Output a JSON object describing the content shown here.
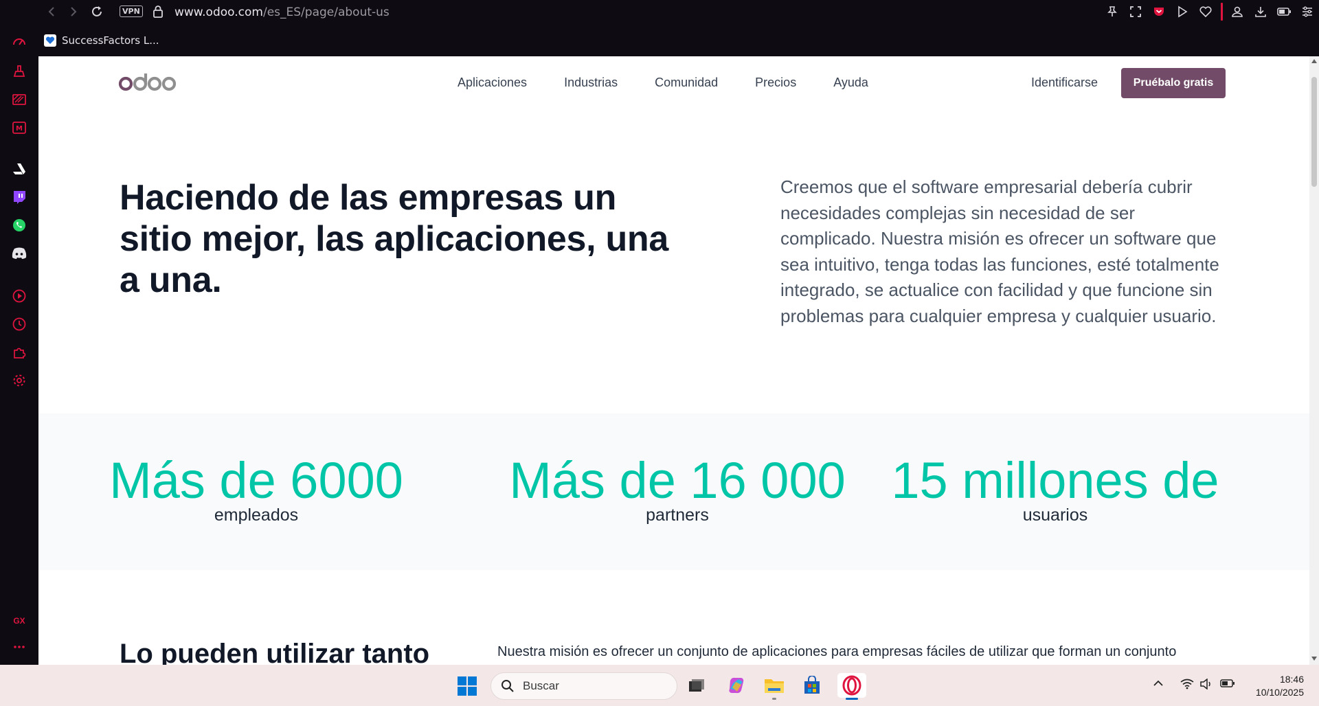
{
  "browser": {
    "vpn_label": "VPN",
    "url_host": "www.odoo.com",
    "url_path": "/es_ES/page/about-us",
    "accent": "#e0153f"
  },
  "bookmarks": [
    {
      "label": "SuccessFactors L..."
    }
  ],
  "sidebar": {
    "gx_label": "GX"
  },
  "site": {
    "logo_text": "odoo",
    "brand_color": "#714b67",
    "menu": [
      {
        "label": "Aplicaciones"
      },
      {
        "label": "Industrias"
      },
      {
        "label": "Comunidad"
      },
      {
        "label": "Precios"
      },
      {
        "label": "Ayuda"
      }
    ],
    "signin_label": "Identificarse",
    "try_label": "Pruébalo gratis"
  },
  "hero": {
    "title": "Haciendo de las empresas un sitio mejor, las aplicaciones, una a una.",
    "text": "Creemos que el software empresarial debería cubrir necesidades complejas sin necesidad de ser complicado. Nuestra misión es ofrecer un software que sea intuitivo, tenga todas las funciones, esté totalmente integrado, se actualice con facilidad y que funcione sin problemas para cualquier empresa y cualquier usuario."
  },
  "stats": [
    {
      "number": "Más de 6000",
      "label": "empleados"
    },
    {
      "number": "Más de 16 000",
      "label": "partners"
    },
    {
      "number": "15 millones de",
      "label": "usuarios"
    }
  ],
  "section2": {
    "title": "Lo pueden utilizar tanto",
    "text": "Nuestra misión es ofrecer un conjunto de aplicaciones para empresas fáciles de utilizar que forman un conjunto"
  },
  "taskbar": {
    "search_placeholder": "Buscar",
    "time": "18:46",
    "date": "10/10/2025"
  }
}
